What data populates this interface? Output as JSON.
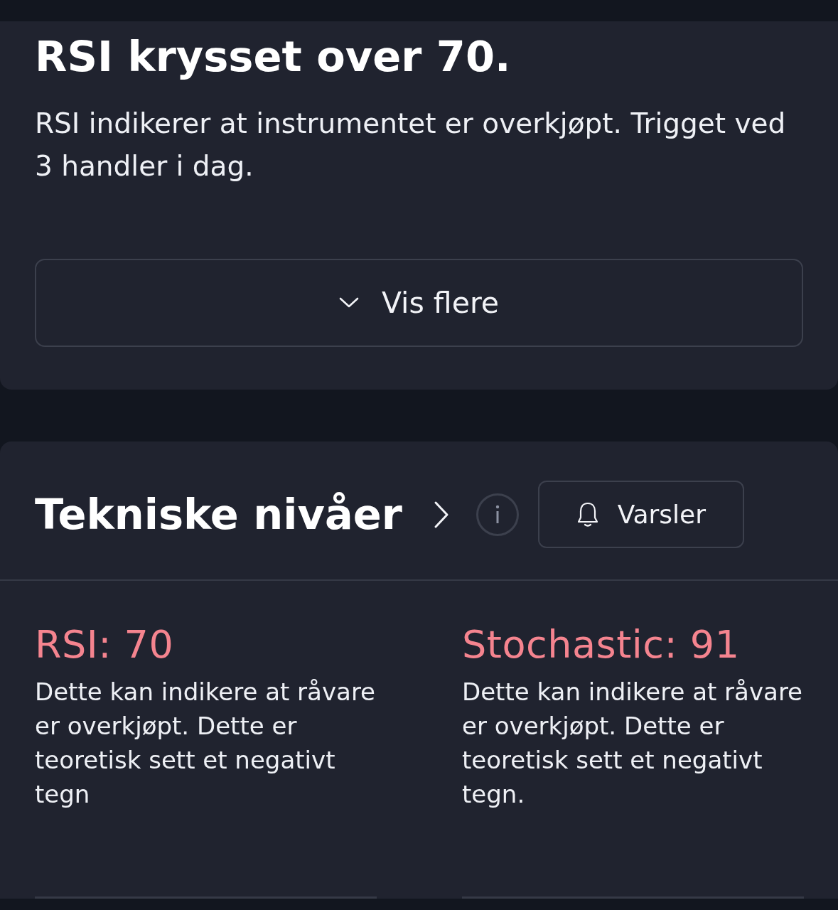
{
  "alert": {
    "title": "RSI krysset over 70.",
    "description": "RSI indikerer at instrumentet er overkjøpt. Trigget ved 3 handler i dag.",
    "expand_button": {
      "label": "Vis flere",
      "expanded": false
    }
  },
  "technical_levels": {
    "title": "Tekniske nivåer",
    "alerts_button": {
      "label": "Varsler"
    },
    "indicators": [
      {
        "label": "RSI: 70",
        "description": "Dette kan indikere at råvare er overkjøpt. Dette er teoretisk sett et negativt tegn"
      },
      {
        "label": "Stochastic: 91",
        "description": "Dette kan indikere at råvare er overkjøpt. Dette er teoretisk sett et negativt tegn."
      }
    ]
  }
}
